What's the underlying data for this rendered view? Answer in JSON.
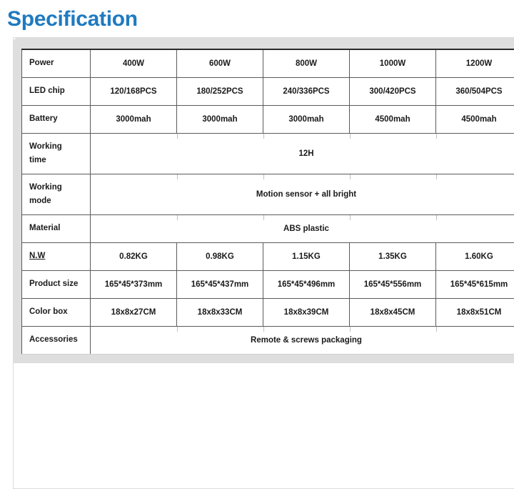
{
  "page": {
    "title": "Specification"
  },
  "table": {
    "rows": [
      {
        "label": "Power",
        "merged": false,
        "values": [
          "400W",
          "600W",
          "800W",
          "1000W",
          "1200W"
        ]
      },
      {
        "label": "LED chip",
        "merged": false,
        "values": [
          "120/168PCS",
          "180/252PCS",
          "240/336PCS",
          "300/420PCS",
          "360/504PCS"
        ]
      },
      {
        "label": "Battery",
        "merged": false,
        "values": [
          "3000mah",
          "3000mah",
          "3000mah",
          "4500mah",
          "4500mah"
        ]
      },
      {
        "label": "Working time",
        "merged": true,
        "values": [
          "12H"
        ]
      },
      {
        "label": "Working mode",
        "merged": true,
        "values": [
          "Motion sensor + all bright"
        ]
      },
      {
        "label": "Material",
        "merged": true,
        "values": [
          "ABS plastic"
        ]
      },
      {
        "label": "N.W",
        "merged": false,
        "underline": true,
        "values": [
          "0.82KG",
          "0.98KG",
          "1.15KG",
          "1.35KG",
          "1.60KG"
        ]
      },
      {
        "label": "Product size",
        "merged": false,
        "values": [
          "165*45*373mm",
          "165*45*437mm",
          "165*45*496mm",
          "165*45*556mm",
          "165*45*615mm"
        ]
      },
      {
        "label": "Color box",
        "merged": false,
        "values": [
          "18x8x27CM",
          "18x8x33CM",
          "18x8x39CM",
          "18x8x45CM",
          "18x8x51CM"
        ]
      },
      {
        "label": "Accessories",
        "merged": true,
        "values": [
          "Remote & screws packaging"
        ]
      }
    ]
  },
  "colors": {
    "title": "#1f7ac0",
    "card_background": "#dedede",
    "table_border": "#5b5b5b",
    "text": "#1a1a1a"
  }
}
